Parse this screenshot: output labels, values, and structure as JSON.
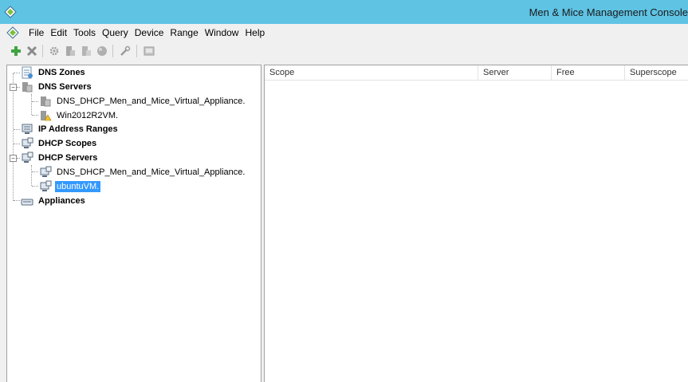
{
  "window": {
    "title": "Men & Mice Management Console",
    "app_icon": "men-and-mice-icon"
  },
  "menu": {
    "items": [
      "File",
      "Edit",
      "Tools",
      "Query",
      "Device",
      "Range",
      "Window",
      "Help"
    ]
  },
  "toolbar": {
    "buttons": [
      "add-icon",
      "delete-icon",
      "gear-icon",
      "server-icon",
      "server-disabled-icon",
      "circle-icon",
      "wrench-icon",
      "terminal-icon"
    ]
  },
  "tree": {
    "dns_zones": "DNS Zones",
    "dns_servers": "DNS Servers",
    "dns_server_1": "DNS_DHCP_Men_and_Mice_Virtual_Appliance.",
    "dns_server_2": "Win2012R2VM.",
    "ip_ranges": "IP Address Ranges",
    "dhcp_scopes": "DHCP Scopes",
    "dhcp_servers": "DHCP Servers",
    "dhcp_server_1": "DNS_DHCP_Men_and_Mice_Virtual_Appliance.",
    "dhcp_server_2": "ubuntuVM.",
    "appliances": "Appliances",
    "selected": "ubuntuVM.",
    "expander_symbol": "−"
  },
  "table": {
    "columns": [
      "Scope",
      "Server",
      "Free",
      "Superscope"
    ]
  },
  "colors": {
    "titlebar": "#5fc3e4",
    "selection": "#3399ff"
  }
}
